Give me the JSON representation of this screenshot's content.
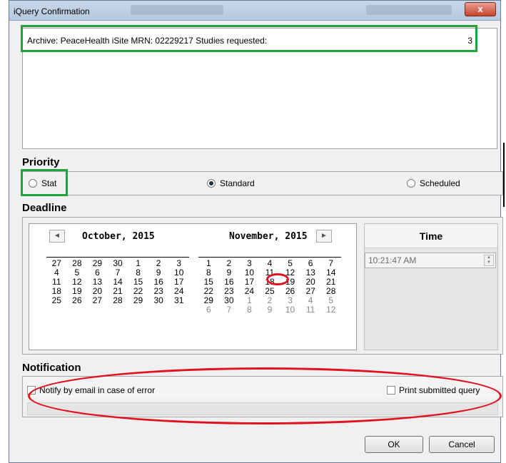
{
  "window": {
    "title": "iQuery Confirmation",
    "close_glyph": "x"
  },
  "summary": {
    "text": "Archive: PeaceHealth iSite  MRN: 02229217  Studies requested:",
    "count": "3"
  },
  "priority": {
    "label": "Priority",
    "options": [
      {
        "label": "Stat",
        "checked": false
      },
      {
        "label": "Standard",
        "checked": true
      },
      {
        "label": "Scheduled",
        "checked": false
      }
    ]
  },
  "deadline": {
    "label": "Deadline",
    "prev_glyph": "◄",
    "next_glyph": "►",
    "months": [
      {
        "title": "October, 2015",
        "days": [
          {
            "d": "27",
            "dim": false
          },
          {
            "d": "28",
            "dim": false
          },
          {
            "d": "29",
            "dim": false
          },
          {
            "d": "30",
            "dim": false
          },
          {
            "d": "1",
            "dim": false
          },
          {
            "d": "2",
            "dim": false
          },
          {
            "d": "3",
            "dim": false
          },
          {
            "d": "4",
            "dim": false
          },
          {
            "d": "5",
            "dim": false
          },
          {
            "d": "6",
            "dim": false
          },
          {
            "d": "7",
            "dim": false
          },
          {
            "d": "8",
            "dim": false
          },
          {
            "d": "9",
            "dim": false
          },
          {
            "d": "10",
            "dim": false
          },
          {
            "d": "11",
            "dim": false
          },
          {
            "d": "12",
            "dim": false
          },
          {
            "d": "13",
            "dim": false
          },
          {
            "d": "14",
            "dim": false
          },
          {
            "d": "15",
            "dim": false
          },
          {
            "d": "16",
            "dim": false
          },
          {
            "d": "17",
            "dim": false
          },
          {
            "d": "18",
            "dim": false
          },
          {
            "d": "19",
            "dim": false
          },
          {
            "d": "20",
            "dim": false
          },
          {
            "d": "21",
            "dim": false
          },
          {
            "d": "22",
            "dim": false
          },
          {
            "d": "23",
            "dim": false
          },
          {
            "d": "24",
            "dim": false
          },
          {
            "d": "25",
            "dim": false
          },
          {
            "d": "26",
            "dim": false
          },
          {
            "d": "27",
            "dim": false
          },
          {
            "d": "28",
            "dim": false
          },
          {
            "d": "29",
            "dim": false
          },
          {
            "d": "30",
            "dim": false
          },
          {
            "d": "31",
            "dim": false
          }
        ]
      },
      {
        "title": "November, 2015",
        "days": [
          {
            "d": "1",
            "dim": false
          },
          {
            "d": "2",
            "dim": false
          },
          {
            "d": "3",
            "dim": false
          },
          {
            "d": "4",
            "dim": false
          },
          {
            "d": "5",
            "dim": false
          },
          {
            "d": "6",
            "dim": false
          },
          {
            "d": "7",
            "dim": false
          },
          {
            "d": "8",
            "dim": false
          },
          {
            "d": "9",
            "dim": false
          },
          {
            "d": "10",
            "dim": false
          },
          {
            "d": "11",
            "dim": false
          },
          {
            "d": "12",
            "dim": false
          },
          {
            "d": "13",
            "dim": false
          },
          {
            "d": "14",
            "dim": false
          },
          {
            "d": "15",
            "dim": false
          },
          {
            "d": "16",
            "dim": false
          },
          {
            "d": "17",
            "dim": false
          },
          {
            "d": "18",
            "dim": false
          },
          {
            "d": "19",
            "dim": false
          },
          {
            "d": "20",
            "dim": false
          },
          {
            "d": "21",
            "dim": false
          },
          {
            "d": "22",
            "dim": false
          },
          {
            "d": "23",
            "dim": false
          },
          {
            "d": "24",
            "dim": false
          },
          {
            "d": "25",
            "dim": false
          },
          {
            "d": "26",
            "dim": false
          },
          {
            "d": "27",
            "dim": false
          },
          {
            "d": "28",
            "dim": false
          },
          {
            "d": "29",
            "dim": false
          },
          {
            "d": "30",
            "dim": false
          },
          {
            "d": "1",
            "dim": true
          },
          {
            "d": "2",
            "dim": true
          },
          {
            "d": "3",
            "dim": true
          },
          {
            "d": "4",
            "dim": true
          },
          {
            "d": "5",
            "dim": true
          },
          {
            "d": "6",
            "dim": true
          },
          {
            "d": "7",
            "dim": true
          },
          {
            "d": "8",
            "dim": true
          },
          {
            "d": "9",
            "dim": true
          },
          {
            "d": "10",
            "dim": true
          },
          {
            "d": "11",
            "dim": true
          },
          {
            "d": "12",
            "dim": true
          }
        ]
      }
    ],
    "time_label": "Time",
    "time_value": "10:21:47 AM"
  },
  "notification": {
    "label": "Notification",
    "email_label": "Notify by email in case of error",
    "print_label": "Print submitted query"
  },
  "buttons": {
    "ok": "OK",
    "cancel": "Cancel"
  },
  "colors": {
    "green_highlight": "#1fa33a",
    "red_highlight": "#e0121f",
    "close_button": "#c7432c"
  }
}
